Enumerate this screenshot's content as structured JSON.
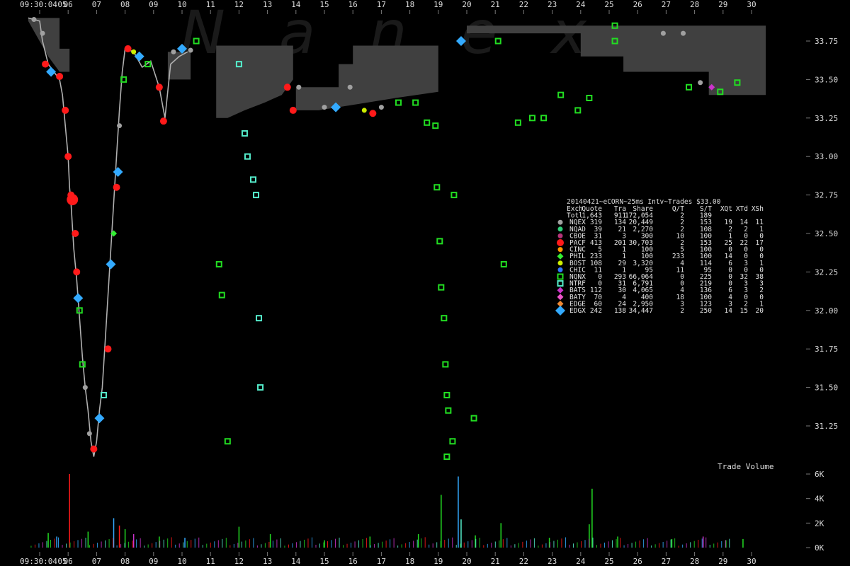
{
  "watermark": "Nanex",
  "chart_data": {
    "type": "scatter",
    "title": "20140421~eCORN~25ms Intv~Trades $33.00",
    "time_start_label": "09:30:04",
    "x_ticks": [
      "05",
      "06",
      "07",
      "08",
      "09",
      "10",
      "11",
      "12",
      "13",
      "14",
      "15",
      "16",
      "17",
      "18",
      "19",
      "20",
      "21",
      "22",
      "23",
      "24",
      "25",
      "26",
      "27",
      "28",
      "29",
      "30"
    ],
    "price_ticks": [
      "33.75",
      "33.50",
      "33.25",
      "33.00",
      "32.75",
      "32.50",
      "32.25",
      "32.00",
      "31.75",
      "31.50",
      "31.25"
    ],
    "price_range": [
      31.0,
      33.95
    ],
    "volume_label": "Trade Volume",
    "volume_ticks": [
      "6K",
      "4K",
      "2K",
      "0K"
    ],
    "volume_range": [
      0,
      6000
    ],
    "colors": {
      "NQEX": "#a0a0a0",
      "NQAD": "#2fd07a",
      "CBOE": "#b5357a",
      "PACF": "#ff1a1a",
      "CINC": "#ff9900",
      "PHIL": "#33ee33",
      "BOST": "#ccee00",
      "CHIC": "#3377ff",
      "NQNX": "#22dd22",
      "NTRF": "#55eecc",
      "BATS": "#cc33cc",
      "BATY": "#ee55cc",
      "EDGE": "#ee8833",
      "EDGX": "#33aaff",
      "spread": "#404040",
      "nbbo_line": "#b0b0b0"
    },
    "table": {
      "header": [
        "Exch",
        "Quote",
        "Tra",
        "Share",
        "Q/T",
        "S/T",
        "XQt",
        "XTd",
        "XSh"
      ],
      "total": [
        "Totl",
        "1,643",
        "911",
        "172,054",
        "2",
        "189",
        "",
        "",
        ""
      ],
      "rows": [
        {
          "exch": "NQEX",
          "shape": "circle",
          "cols": [
            "319",
            "134",
            "20,449",
            "2",
            "153",
            "19",
            "14",
            "11"
          ]
        },
        {
          "exch": "NQAD",
          "shape": "circle",
          "cols": [
            "39",
            "21",
            "2,270",
            "2",
            "108",
            "2",
            "2",
            "1"
          ]
        },
        {
          "exch": "CBOE",
          "shape": "circle",
          "cols": [
            "31",
            "3",
            "300",
            "10",
            "100",
            "1",
            "0",
            "0"
          ]
        },
        {
          "exch": "PACF",
          "shape": "circle-big",
          "cols": [
            "413",
            "201",
            "30,703",
            "2",
            "153",
            "25",
            "22",
            "17"
          ]
        },
        {
          "exch": "CINC",
          "shape": "circle",
          "cols": [
            "5",
            "1",
            "100",
            "5",
            "100",
            "0",
            "0",
            "0"
          ]
        },
        {
          "exch": "PHIL",
          "shape": "diamond",
          "cols": [
            "233",
            "1",
            "100",
            "233",
            "100",
            "14",
            "0",
            "0"
          ]
        },
        {
          "exch": "BOST",
          "shape": "circle",
          "cols": [
            "108",
            "29",
            "3,320",
            "4",
            "114",
            "6",
            "3",
            "1"
          ]
        },
        {
          "exch": "CHIC",
          "shape": "circle",
          "cols": [
            "11",
            "1",
            "95",
            "11",
            "95",
            "0",
            "0",
            "0"
          ]
        },
        {
          "exch": "NQNX",
          "shape": "square",
          "cols": [
            "0",
            "293",
            "66,064",
            "0",
            "225",
            "0",
            "32",
            "38"
          ]
        },
        {
          "exch": "NTRF",
          "shape": "square",
          "cols": [
            "0",
            "31",
            "6,791",
            "0",
            "219",
            "0",
            "3",
            "3"
          ]
        },
        {
          "exch": "BATS",
          "shape": "diamond",
          "cols": [
            "112",
            "30",
            "4,065",
            "4",
            "136",
            "6",
            "3",
            "2"
          ]
        },
        {
          "exch": "BATY",
          "shape": "diamond",
          "cols": [
            "70",
            "4",
            "400",
            "18",
            "100",
            "4",
            "0",
            "0"
          ]
        },
        {
          "exch": "EDGE",
          "shape": "diamond",
          "cols": [
            "60",
            "24",
            "2,950",
            "3",
            "123",
            "3",
            "2",
            "1"
          ]
        },
        {
          "exch": "EDGX",
          "shape": "diamond-big",
          "cols": [
            "242",
            "138",
            "34,447",
            "2",
            "250",
            "14",
            "15",
            "20"
          ]
        }
      ]
    },
    "price_path": [
      [
        4.6,
        33.9
      ],
      [
        5.0,
        33.88
      ],
      [
        5.1,
        33.75
      ],
      [
        5.3,
        33.6
      ],
      [
        5.5,
        33.55
      ],
      [
        5.7,
        33.5
      ],
      [
        5.8,
        33.4
      ],
      [
        5.9,
        33.2
      ],
      [
        6.0,
        33.0
      ],
      [
        6.05,
        32.8
      ],
      [
        6.1,
        32.7
      ],
      [
        6.2,
        32.4
      ],
      [
        6.3,
        32.2
      ],
      [
        6.4,
        31.95
      ],
      [
        6.5,
        31.7
      ],
      [
        6.6,
        31.5
      ],
      [
        6.7,
        31.35
      ],
      [
        6.8,
        31.15
      ],
      [
        6.9,
        31.05
      ],
      [
        7.0,
        31.15
      ],
      [
        7.1,
        31.35
      ],
      [
        7.2,
        31.5
      ],
      [
        7.3,
        31.8
      ],
      [
        7.4,
        32.1
      ],
      [
        7.5,
        32.4
      ],
      [
        7.6,
        32.7
      ],
      [
        7.7,
        33.0
      ],
      [
        7.8,
        33.3
      ],
      [
        7.9,
        33.55
      ],
      [
        8.0,
        33.7
      ],
      [
        8.3,
        33.68
      ],
      [
        8.6,
        33.58
      ],
      [
        8.9,
        33.62
      ],
      [
        9.2,
        33.45
      ],
      [
        9.4,
        33.25
      ],
      [
        9.6,
        33.6
      ],
      [
        9.9,
        33.65
      ],
      [
        10.2,
        33.68
      ]
    ],
    "spread_polys": [
      [
        [
          4.6,
          33.9
        ],
        [
          5.7,
          33.9
        ],
        [
          5.7,
          33.7
        ],
        [
          6.05,
          33.7
        ],
        [
          6.05,
          33.55
        ],
        [
          5.7,
          33.55
        ],
        [
          5.3,
          33.65
        ],
        [
          4.6,
          33.88
        ]
      ],
      [
        [
          9.5,
          33.68
        ],
        [
          10.3,
          33.68
        ],
        [
          10.3,
          33.5
        ],
        [
          9.5,
          33.5
        ]
      ],
      [
        [
          11.2,
          33.72
        ],
        [
          13.9,
          33.72
        ],
        [
          13.9,
          33.5
        ],
        [
          13.5,
          33.4
        ],
        [
          12.9,
          33.35
        ],
        [
          12.2,
          33.3
        ],
        [
          11.6,
          33.25
        ],
        [
          11.2,
          33.25
        ]
      ],
      [
        [
          14.0,
          33.45
        ],
        [
          15.5,
          33.45
        ],
        [
          15.5,
          33.6
        ],
        [
          16.0,
          33.6
        ],
        [
          16.0,
          33.72
        ],
        [
          19.0,
          33.72
        ],
        [
          19.0,
          33.42
        ],
        [
          17.5,
          33.38
        ],
        [
          16.5,
          33.35
        ],
        [
          14.8,
          33.3
        ],
        [
          14.0,
          33.3
        ]
      ],
      [
        [
          20.0,
          33.85
        ],
        [
          30.5,
          33.85
        ],
        [
          30.5,
          33.4
        ],
        [
          28.5,
          33.4
        ],
        [
          28.5,
          33.55
        ],
        [
          25.5,
          33.55
        ],
        [
          25.5,
          33.65
        ],
        [
          24.0,
          33.65
        ],
        [
          24.0,
          33.8
        ],
        [
          20.0,
          33.8
        ]
      ]
    ],
    "points": [
      {
        "ex": "NQEX",
        "x": 4.8,
        "p": 33.89
      },
      {
        "ex": "NQEX",
        "x": 5.1,
        "p": 33.8
      },
      {
        "ex": "PACF",
        "x": 5.2,
        "p": 33.6
      },
      {
        "ex": "EDGX",
        "x": 5.4,
        "p": 33.55
      },
      {
        "ex": "PACF",
        "x": 5.7,
        "p": 33.52
      },
      {
        "ex": "PACF",
        "x": 5.9,
        "p": 33.3
      },
      {
        "ex": "PACF",
        "x": 6.0,
        "p": 33.0
      },
      {
        "ex": "PACF",
        "x": 6.1,
        "p": 32.75
      },
      {
        "ex": "PACF",
        "x": 6.15,
        "p": 32.72,
        "big": true
      },
      {
        "ex": "PACF",
        "x": 6.25,
        "p": 32.5
      },
      {
        "ex": "PACF",
        "x": 6.3,
        "p": 32.25
      },
      {
        "ex": "EDGX",
        "x": 6.35,
        "p": 32.08
      },
      {
        "ex": "NQNX",
        "x": 6.4,
        "p": 32.0
      },
      {
        "ex": "NQNX",
        "x": 6.5,
        "p": 31.65
      },
      {
        "ex": "NQEX",
        "x": 6.6,
        "p": 31.5
      },
      {
        "ex": "NQEX",
        "x": 6.75,
        "p": 31.2
      },
      {
        "ex": "PACF",
        "x": 6.9,
        "p": 31.1
      },
      {
        "ex": "EDGX",
        "x": 7.1,
        "p": 31.3
      },
      {
        "ex": "NTRF",
        "x": 7.25,
        "p": 31.45
      },
      {
        "ex": "PACF",
        "x": 7.4,
        "p": 31.75
      },
      {
        "ex": "EDGX",
        "x": 7.5,
        "p": 32.3
      },
      {
        "ex": "PHIL",
        "x": 7.6,
        "p": 32.5
      },
      {
        "ex": "PACF",
        "x": 7.7,
        "p": 32.8
      },
      {
        "ex": "EDGX",
        "x": 7.75,
        "p": 32.9
      },
      {
        "ex": "NQEX",
        "x": 7.8,
        "p": 33.2
      },
      {
        "ex": "NQNX",
        "x": 7.95,
        "p": 33.5
      },
      {
        "ex": "PACF",
        "x": 8.1,
        "p": 33.7
      },
      {
        "ex": "BOST",
        "x": 8.3,
        "p": 33.68
      },
      {
        "ex": "EDGX",
        "x": 8.5,
        "p": 33.65
      },
      {
        "ex": "NQNX",
        "x": 8.8,
        "p": 33.6
      },
      {
        "ex": "PACF",
        "x": 9.2,
        "p": 33.45
      },
      {
        "ex": "PACF",
        "x": 9.35,
        "p": 33.23
      },
      {
        "ex": "NQEX",
        "x": 9.7,
        "p": 33.68
      },
      {
        "ex": "EDGX",
        "x": 10.0,
        "p": 33.7
      },
      {
        "ex": "NQEX",
        "x": 10.3,
        "p": 33.69
      },
      {
        "ex": "NQNX",
        "x": 10.5,
        "p": 33.75
      },
      {
        "ex": "NTRF",
        "x": 12.0,
        "p": 33.6
      },
      {
        "ex": "NTRF",
        "x": 12.2,
        "p": 33.15
      },
      {
        "ex": "NTRF",
        "x": 12.3,
        "p": 33.0
      },
      {
        "ex": "NTRF",
        "x": 12.5,
        "p": 32.85
      },
      {
        "ex": "NTRF",
        "x": 12.6,
        "p": 32.75
      },
      {
        "ex": "NTRF",
        "x": 12.7,
        "p": 31.95
      },
      {
        "ex": "NTRF",
        "x": 12.75,
        "p": 31.5
      },
      {
        "ex": "NQNX",
        "x": 11.3,
        "p": 32.3
      },
      {
        "ex": "NQNX",
        "x": 11.4,
        "p": 32.1
      },
      {
        "ex": "NQNX",
        "x": 11.6,
        "p": 31.15
      },
      {
        "ex": "PACF",
        "x": 13.7,
        "p": 33.45
      },
      {
        "ex": "PACF",
        "x": 13.9,
        "p": 33.3
      },
      {
        "ex": "NQEX",
        "x": 14.1,
        "p": 33.45
      },
      {
        "ex": "NQEX",
        "x": 15.0,
        "p": 33.32
      },
      {
        "ex": "EDGX",
        "x": 15.4,
        "p": 33.32
      },
      {
        "ex": "NQEX",
        "x": 15.9,
        "p": 33.45
      },
      {
        "ex": "BOST",
        "x": 16.4,
        "p": 33.3
      },
      {
        "ex": "PACF",
        "x": 16.7,
        "p": 33.28
      },
      {
        "ex": "NQEX",
        "x": 17.0,
        "p": 33.32
      },
      {
        "ex": "NQNX",
        "x": 17.6,
        "p": 33.35
      },
      {
        "ex": "NQNX",
        "x": 18.2,
        "p": 33.35
      },
      {
        "ex": "NQNX",
        "x": 18.6,
        "p": 33.22
      },
      {
        "ex": "NQNX",
        "x": 18.9,
        "p": 33.2
      },
      {
        "ex": "NQNX",
        "x": 18.95,
        "p": 32.8
      },
      {
        "ex": "NQNX",
        "x": 19.05,
        "p": 32.45
      },
      {
        "ex": "NQNX",
        "x": 19.1,
        "p": 32.15
      },
      {
        "ex": "NQNX",
        "x": 19.2,
        "p": 31.95
      },
      {
        "ex": "NQNX",
        "x": 19.25,
        "p": 31.65
      },
      {
        "ex": "NQNX",
        "x": 19.3,
        "p": 31.45
      },
      {
        "ex": "NQNX",
        "x": 19.35,
        "p": 31.35
      },
      {
        "ex": "NQNX",
        "x": 19.3,
        "p": 31.05
      },
      {
        "ex": "NQNX",
        "x": 19.5,
        "p": 31.15
      },
      {
        "ex": "NQNX",
        "x": 19.55,
        "p": 32.75
      },
      {
        "ex": "EDGX",
        "x": 19.8,
        "p": 33.75
      },
      {
        "ex": "NQNX",
        "x": 20.25,
        "p": 31.3
      },
      {
        "ex": "NQNX",
        "x": 21.1,
        "p": 33.75
      },
      {
        "ex": "NQNX",
        "x": 21.3,
        "p": 32.3
      },
      {
        "ex": "NQNX",
        "x": 21.8,
        "p": 33.22
      },
      {
        "ex": "NQNX",
        "x": 22.3,
        "p": 33.25
      },
      {
        "ex": "NQNX",
        "x": 22.7,
        "p": 33.25
      },
      {
        "ex": "NQNX",
        "x": 23.3,
        "p": 33.4
      },
      {
        "ex": "NQNX",
        "x": 23.9,
        "p": 33.3
      },
      {
        "ex": "NQNX",
        "x": 24.3,
        "p": 33.38
      },
      {
        "ex": "NQNX",
        "x": 25.2,
        "p": 33.85
      },
      {
        "ex": "NQNX",
        "x": 25.2,
        "p": 33.75
      },
      {
        "ex": "NQEX",
        "x": 26.9,
        "p": 33.8
      },
      {
        "ex": "NQEX",
        "x": 27.6,
        "p": 33.8
      },
      {
        "ex": "NQNX",
        "x": 27.8,
        "p": 33.45
      },
      {
        "ex": "NQEX",
        "x": 28.2,
        "p": 33.48
      },
      {
        "ex": "BATS",
        "x": 28.6,
        "p": 33.45
      },
      {
        "ex": "NQNX",
        "x": 28.9,
        "p": 33.42
      },
      {
        "ex": "NQNX",
        "x": 29.5,
        "p": 33.48
      }
    ],
    "volume_bars": [
      {
        "x": 6.05,
        "v": 6000,
        "ex": "PACF"
      },
      {
        "x": 5.3,
        "v": 1200,
        "ex": "NQNX"
      },
      {
        "x": 5.6,
        "v": 900,
        "ex": "EDGX"
      },
      {
        "x": 7.6,
        "v": 2400,
        "ex": "EDGX"
      },
      {
        "x": 7.8,
        "v": 1800,
        "ex": "PACF"
      },
      {
        "x": 8.0,
        "v": 1500,
        "ex": "NQNX"
      },
      {
        "x": 8.3,
        "v": 1100,
        "ex": "BATS"
      },
      {
        "x": 6.7,
        "v": 1300,
        "ex": "NQNX"
      },
      {
        "x": 9.2,
        "v": 900,
        "ex": "NQNX"
      },
      {
        "x": 10.1,
        "v": 800,
        "ex": "EDGX"
      },
      {
        "x": 12.0,
        "v": 1700,
        "ex": "NQNX"
      },
      {
        "x": 13.1,
        "v": 1100,
        "ex": "NQNX"
      },
      {
        "x": 15.0,
        "v": 600,
        "ex": "NQNX"
      },
      {
        "x": 16.6,
        "v": 900,
        "ex": "NQNX"
      },
      {
        "x": 18.3,
        "v": 1100,
        "ex": "NQNX"
      },
      {
        "x": 19.1,
        "v": 4300,
        "ex": "NQNX"
      },
      {
        "x": 19.7,
        "v": 5800,
        "ex": "EDGX"
      },
      {
        "x": 19.8,
        "v": 2300,
        "ex": "NTRF"
      },
      {
        "x": 20.3,
        "v": 1000,
        "ex": "NQNX"
      },
      {
        "x": 21.2,
        "v": 2000,
        "ex": "NQNX"
      },
      {
        "x": 22.9,
        "v": 800,
        "ex": "NQNX"
      },
      {
        "x": 24.4,
        "v": 4800,
        "ex": "NQNX"
      },
      {
        "x": 24.3,
        "v": 1900,
        "ex": "NQNX"
      },
      {
        "x": 25.3,
        "v": 900,
        "ex": "NQNX"
      },
      {
        "x": 27.2,
        "v": 700,
        "ex": "NQNX"
      },
      {
        "x": 28.3,
        "v": 900,
        "ex": "BATS"
      },
      {
        "x": 29.1,
        "v": 600,
        "ex": "NQNX"
      },
      {
        "x": 29.7,
        "v": 700,
        "ex": "NQNX"
      }
    ]
  }
}
